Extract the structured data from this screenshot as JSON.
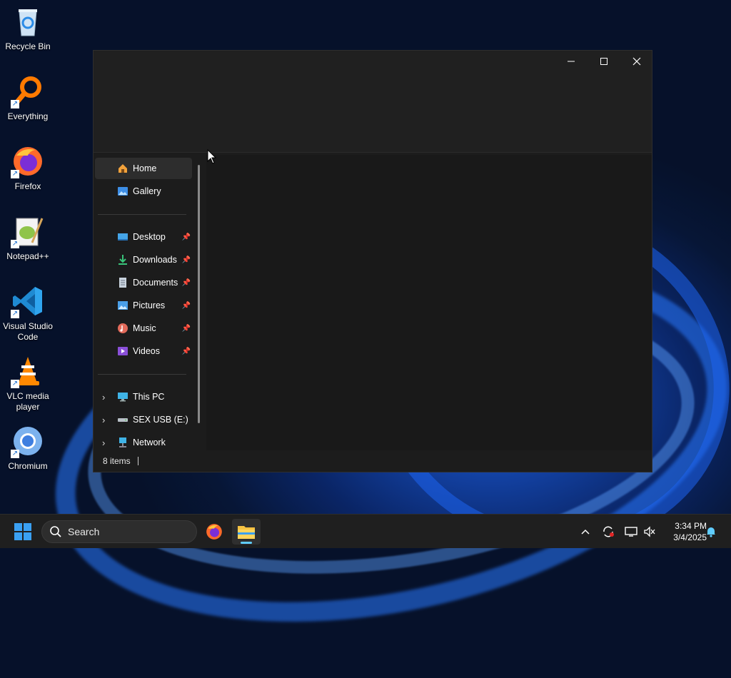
{
  "desktop": {
    "icons": [
      {
        "label": "Recycle Bin",
        "icon": "recycle-bin-icon"
      },
      {
        "label": "Everything",
        "icon": "everything-search-icon"
      },
      {
        "label": "Firefox",
        "icon": "firefox-icon"
      },
      {
        "label": "Notepad++",
        "icon": "notepad-plus-plus-icon"
      },
      {
        "label": "Visual Studio Code",
        "icon": "vscode-icon"
      },
      {
        "label": "VLC media player",
        "icon": "vlc-icon"
      },
      {
        "label": "Chromium",
        "icon": "chromium-icon"
      }
    ]
  },
  "window": {
    "caption": {
      "minimize": "—",
      "maximize": "☐",
      "close": "✕"
    },
    "nav": {
      "top": [
        {
          "label": "Home",
          "icon": "home-icon",
          "selected": true
        },
        {
          "label": "Gallery",
          "icon": "gallery-icon"
        }
      ],
      "quick_access": [
        {
          "label": "Desktop",
          "icon": "desktop-folder-icon",
          "pinned": true
        },
        {
          "label": "Downloads",
          "icon": "downloads-folder-icon",
          "pinned": true
        },
        {
          "label": "Documents",
          "icon": "documents-folder-icon",
          "pinned": true
        },
        {
          "label": "Pictures",
          "icon": "pictures-folder-icon",
          "pinned": true
        },
        {
          "label": "Music",
          "icon": "music-folder-icon",
          "pinned": true
        },
        {
          "label": "Videos",
          "icon": "videos-folder-icon",
          "pinned": true
        }
      ],
      "locations": [
        {
          "label": "This PC",
          "icon": "this-pc-icon"
        },
        {
          "label": "SEX USB (E:)",
          "icon": "usb-drive-icon"
        },
        {
          "label": "Network",
          "icon": "network-icon"
        }
      ]
    },
    "status": {
      "item_count": "8 items"
    }
  },
  "taskbar": {
    "search_label": "Search",
    "apps": [
      "firefox-icon",
      "file-explorer-icon"
    ],
    "tray": [
      "chevron-up-icon",
      "sync-icon",
      "display-icon",
      "speaker-muted-icon"
    ],
    "time": "3:34 PM",
    "date": "3/4/2025"
  },
  "colors": {
    "accent": "#60cdff",
    "window_bg": "#1c1c1c",
    "taskbar_bg": "#1f1f1f"
  }
}
